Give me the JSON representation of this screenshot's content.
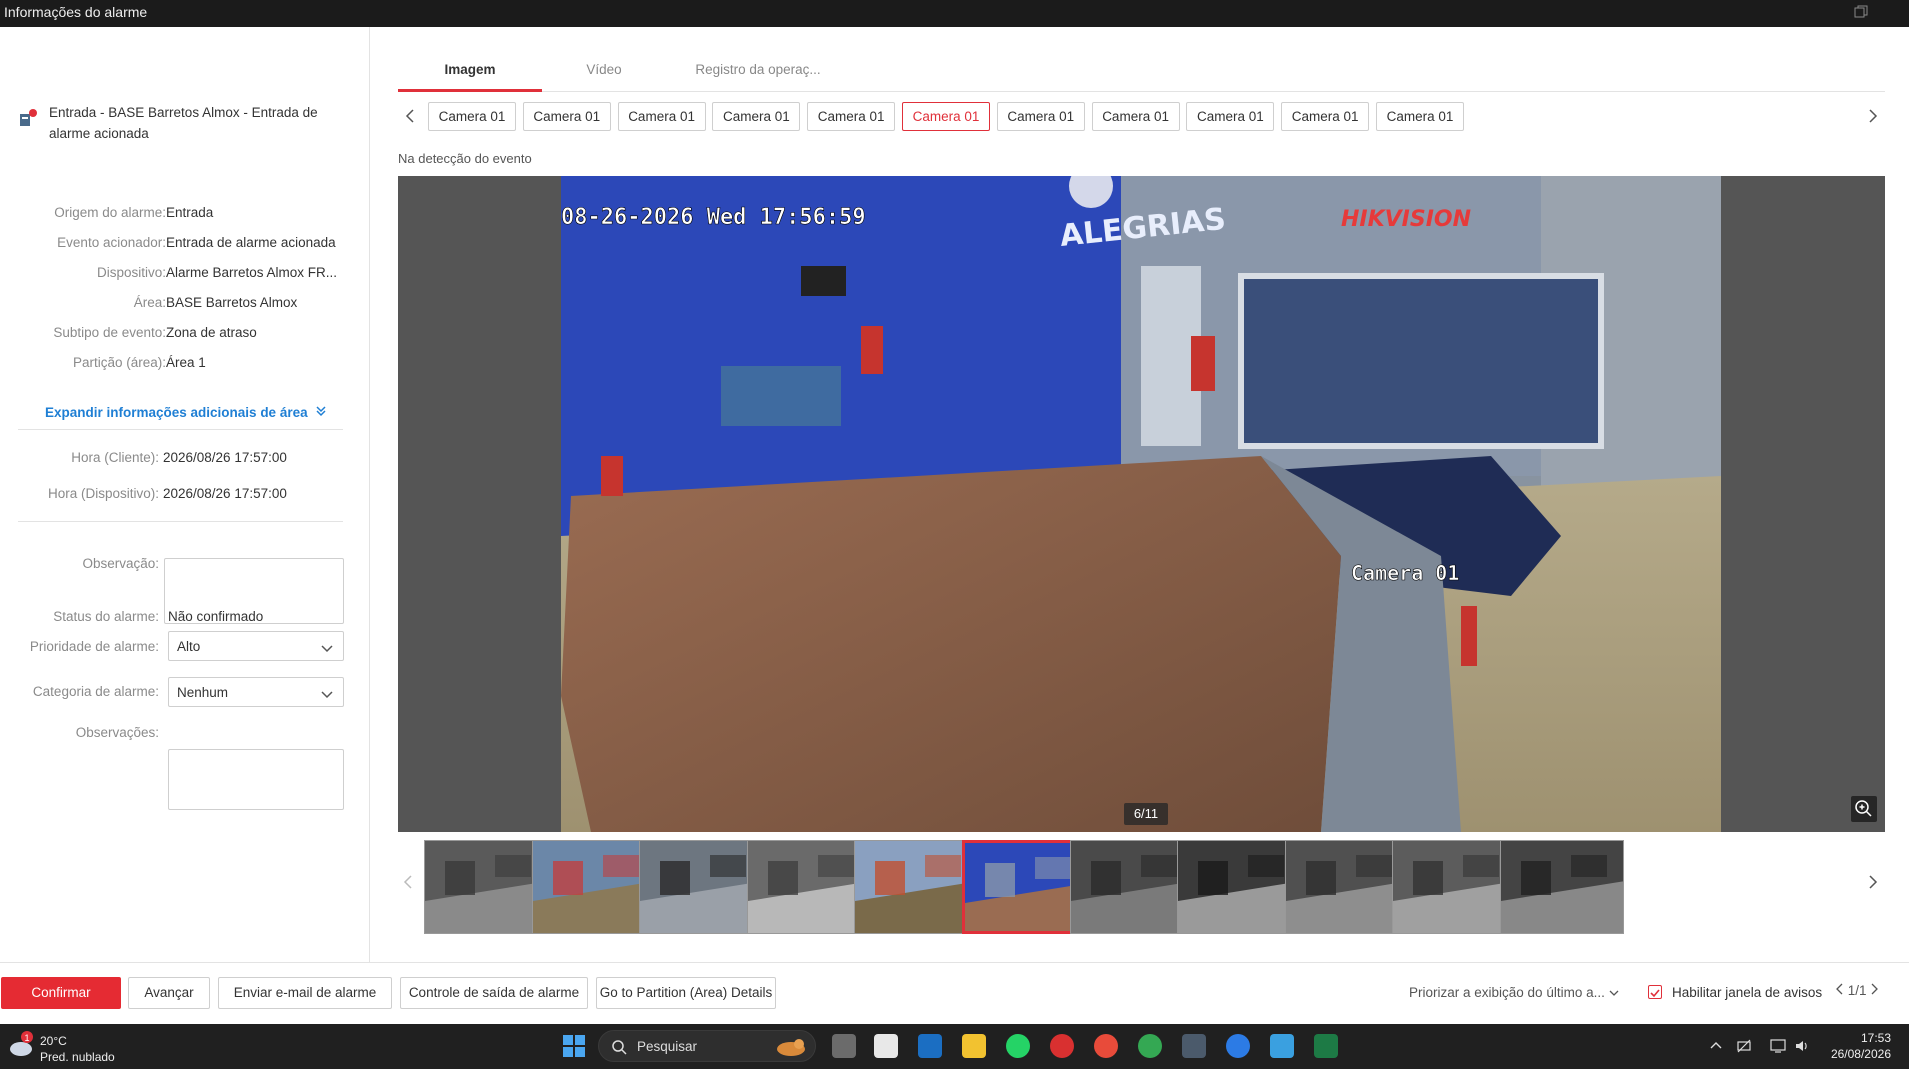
{
  "window": {
    "title": "Informações do alarme"
  },
  "alarm": {
    "headline": "Entrada - BASE Barretos Almox - Entrada de alarme acionada"
  },
  "details": [
    {
      "label": "Origem do alarme:",
      "value": "Entrada"
    },
    {
      "label": "Evento acionador:",
      "value": "Entrada de alarme acionada"
    },
    {
      "label": "Dispositivo:",
      "value": "Alarme Barretos Almox FR..."
    },
    {
      "label": "Área:",
      "value": "BASE Barretos Almox"
    },
    {
      "label": "Subtipo de evento:",
      "value": "Zona de atraso"
    },
    {
      "label": "Partição (área):",
      "value": "Área 1"
    }
  ],
  "expand_label": "Expandir informações adicionais de área",
  "times": [
    {
      "label": "Hora (Cliente):",
      "value": "2026/08/26 17:57:00"
    },
    {
      "label": "Hora (Dispositivo):",
      "value": "2026/08/26 17:57:00"
    }
  ],
  "form": {
    "observacao_label": "Observação:",
    "status_label": "Status do alarme:",
    "status_value": "Não confirmado",
    "prioridade_label": "Prioridade de alarme:",
    "prioridade_value": "Alto",
    "categoria_label": "Categoria de alarme:",
    "categoria_value": "Nenhum",
    "observacoes_label": "Observações:"
  },
  "tabs": [
    "Imagem",
    "Vídeo",
    "Registro da operaç..."
  ],
  "cameras": [
    "Camera 01",
    "Camera 01",
    "Camera 01",
    "Camera 01",
    "Camera 01",
    "Camera 01",
    "Camera 01",
    "Camera 01",
    "Camera 01",
    "Camera 01",
    "Camera 01"
  ],
  "active_camera_index": 5,
  "detect_label": "Na detecção do evento",
  "viewer": {
    "osd_timestamp": "08-26-2026 Wed 17:56:59",
    "osd_brand": "HIKVISION",
    "osd_camera": "Camera 01",
    "wall_text": "ALEGRIAS",
    "counter": "6/11"
  },
  "actions": {
    "confirm": "Confirmar",
    "advance": "Avançar",
    "email": "Enviar e-mail de alarme",
    "output": "Controle de saída de alarme",
    "partition": "Go to Partition (Area) Details",
    "priorizar": "Priorizar a exibição do último a...",
    "habilitar": "Habilitar janela de avisos",
    "pager": "1/1"
  },
  "taskbar": {
    "weather_temp": "20°C",
    "weather_desc": "Pred. nublado",
    "weather_badge": "1",
    "search_placeholder": "Pesquisar",
    "time": "17:53",
    "date": "26/08/2026"
  },
  "colors": {
    "accent": "#e0303a",
    "link": "#1f7fd4",
    "taskbar": "#202020"
  }
}
